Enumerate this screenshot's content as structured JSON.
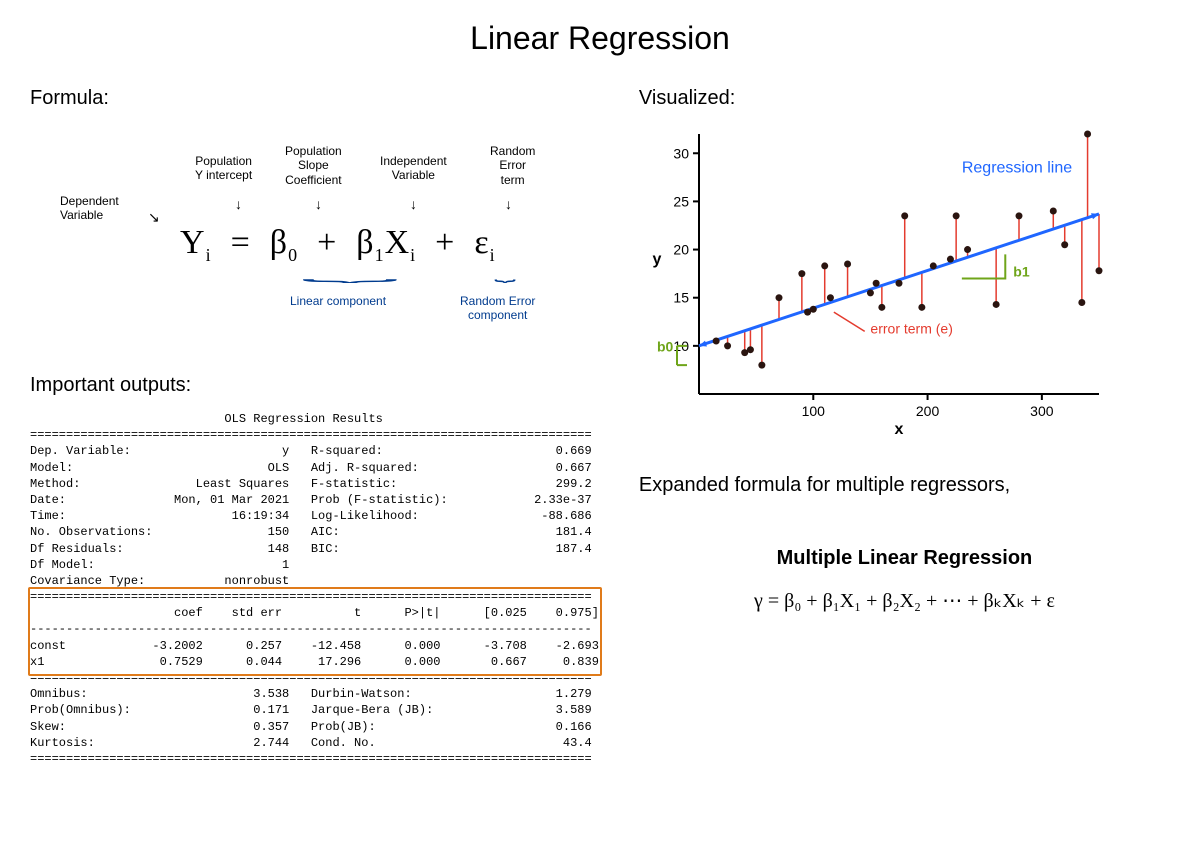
{
  "title": "Linear Regression",
  "formula_section_label": "Formula:",
  "formula_labels": {
    "dep": "Dependent\nVariable",
    "intercept": "Population\nY  intercept",
    "slope": "Population\nSlope\nCoefficient",
    "indep": "Independent\nVariable",
    "error": "Random\nError\nterm",
    "linear_comp": "Linear component",
    "rand_comp": "Random Error\ncomponent"
  },
  "formula_terms": {
    "y": "Y",
    "i": "i",
    "eq": "=",
    "b0": "β",
    "zero": "0",
    "plus": "+",
    "b1": "β",
    "one": "1",
    "x": "X",
    "eps": "ε"
  },
  "outputs_label": "Important outputs:",
  "ols": {
    "header": "OLS Regression Results",
    "rows_top": [
      [
        "Dep. Variable:",
        "y",
        "R-squared:",
        "0.669"
      ],
      [
        "Model:",
        "OLS",
        "Adj. R-squared:",
        "0.667"
      ],
      [
        "Method:",
        "Least Squares",
        "F-statistic:",
        "299.2"
      ],
      [
        "Date:",
        "Mon, 01 Mar 2021",
        "Prob (F-statistic):",
        "2.33e-37"
      ],
      [
        "Time:",
        "16:19:34",
        "Log-Likelihood:",
        "-88.686"
      ],
      [
        "No. Observations:",
        "150",
        "AIC:",
        "181.4"
      ],
      [
        "Df Residuals:",
        "148",
        "BIC:",
        "187.4"
      ],
      [
        "Df Model:",
        "1",
        "",
        ""
      ],
      [
        "Covariance Type:",
        "nonrobust",
        "",
        ""
      ]
    ],
    "coef_header": [
      "",
      "coef",
      "std err",
      "t",
      "P>|t|",
      "[0.025",
      "0.975]"
    ],
    "coef_rows": [
      [
        "const",
        "-3.2002",
        "0.257",
        "-12.458",
        "0.000",
        "-3.708",
        "-2.693"
      ],
      [
        "x1",
        "0.7529",
        "0.044",
        "17.296",
        "0.000",
        "0.667",
        "0.839"
      ]
    ],
    "rows_bottom": [
      [
        "Omnibus:",
        "3.538",
        "Durbin-Watson:",
        "1.279"
      ],
      [
        "Prob(Omnibus):",
        "0.171",
        "Jarque-Bera (JB):",
        "3.589"
      ],
      [
        "Skew:",
        "0.357",
        "Prob(JB):",
        "0.166"
      ],
      [
        "Kurtosis:",
        "2.744",
        "Cond. No.",
        "43.4"
      ]
    ]
  },
  "viz_label": "Visualized:",
  "chart_data": {
    "type": "scatter",
    "xlabel": "x",
    "ylabel": "y",
    "xrange": [
      0,
      350
    ],
    "yrange": [
      5,
      32
    ],
    "xticks": [
      100,
      200,
      300
    ],
    "yticks": [
      10,
      15,
      20,
      25,
      30
    ],
    "points": [
      {
        "x": 15,
        "y": 10.5
      },
      {
        "x": 25,
        "y": 10
      },
      {
        "x": 40,
        "y": 9.3
      },
      {
        "x": 45,
        "y": 9.6
      },
      {
        "x": 55,
        "y": 8
      },
      {
        "x": 70,
        "y": 15
      },
      {
        "x": 90,
        "y": 17.5
      },
      {
        "x": 95,
        "y": 13.5
      },
      {
        "x": 100,
        "y": 13.8
      },
      {
        "x": 110,
        "y": 18.3
      },
      {
        "x": 115,
        "y": 15
      },
      {
        "x": 130,
        "y": 18.5
      },
      {
        "x": 150,
        "y": 15.5
      },
      {
        "x": 155,
        "y": 16.5
      },
      {
        "x": 160,
        "y": 14
      },
      {
        "x": 175,
        "y": 16.5
      },
      {
        "x": 180,
        "y": 23.5
      },
      {
        "x": 195,
        "y": 14
      },
      {
        "x": 205,
        "y": 18.3
      },
      {
        "x": 220,
        "y": 19
      },
      {
        "x": 225,
        "y": 23.5
      },
      {
        "x": 235,
        "y": 20
      },
      {
        "x": 260,
        "y": 14.3
      },
      {
        "x": 280,
        "y": 23.5
      },
      {
        "x": 310,
        "y": 24
      },
      {
        "x": 320,
        "y": 20.5
      },
      {
        "x": 335,
        "y": 14.5
      },
      {
        "x": 340,
        "y": 32
      },
      {
        "x": 350,
        "y": 17.8
      }
    ],
    "regression": {
      "x1": 0,
      "y1": 10,
      "x2": 350,
      "y2": 23.7
    },
    "annotations": {
      "regline": "Regression line",
      "b0": "b0",
      "b1": "b1",
      "error": "error term (e)"
    }
  },
  "expanded_caption": "Expanded formula for multiple regressors,",
  "mlr_title": "Multiple Linear Regression",
  "mlr_equation": "γ = β₀  +  β₁X₁ + β₂X₂ + ⋯ + βₖXₖ  +  ε"
}
